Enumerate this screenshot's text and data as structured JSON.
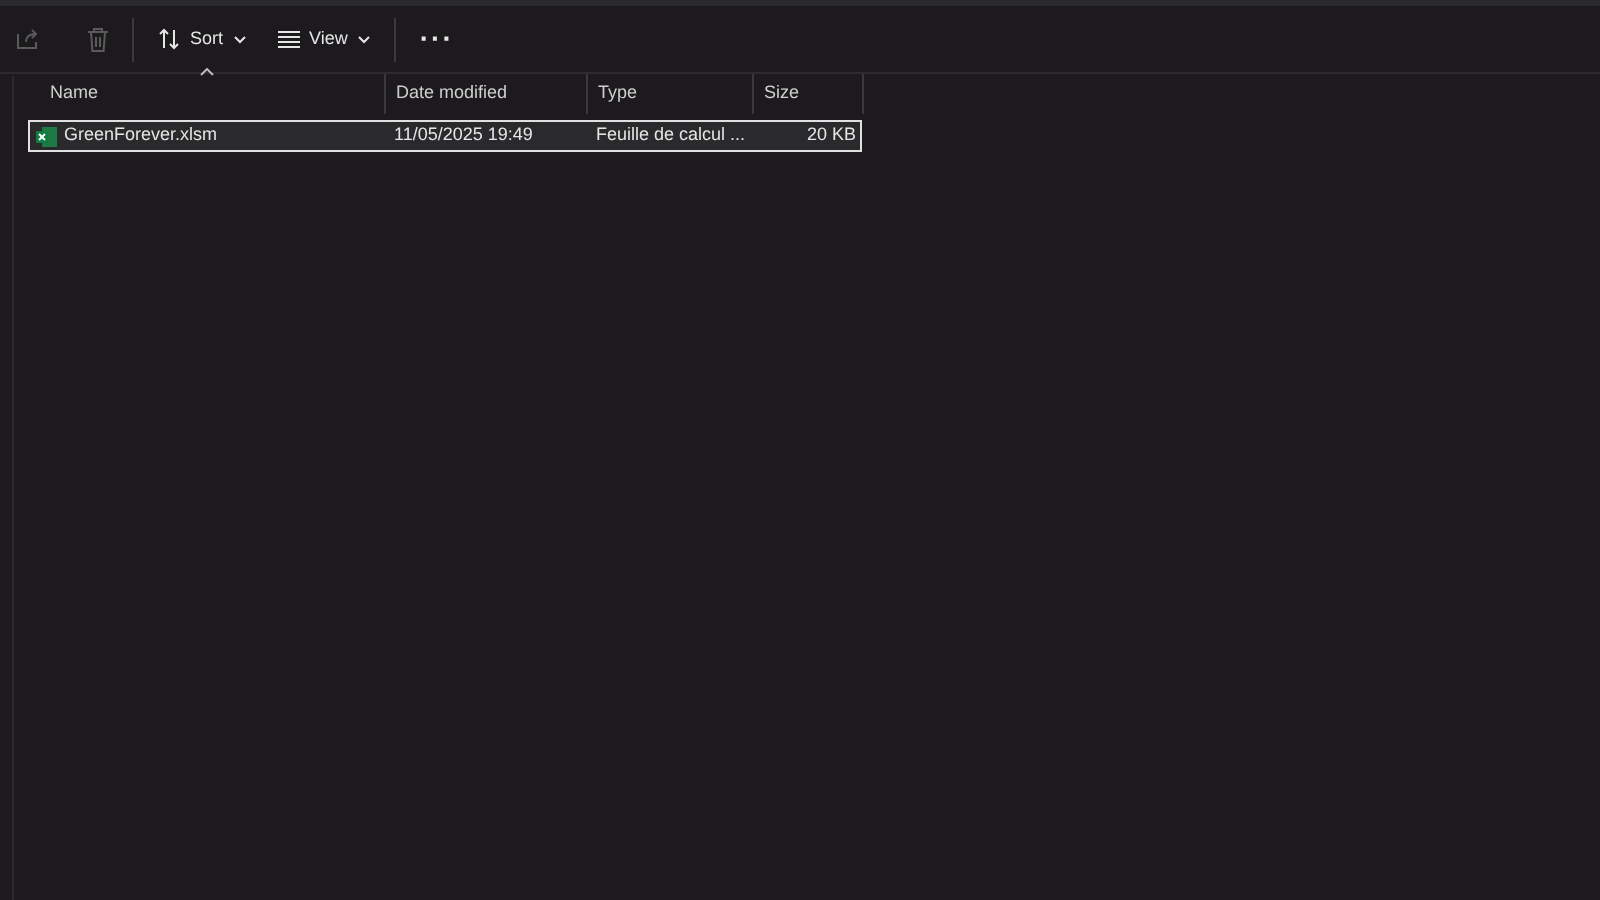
{
  "toolbar": [
    {
      "kind": "share",
      "disabled": true
    },
    {
      "kind": "delete",
      "disabled": true
    },
    {
      "kind": "sort",
      "label": "Sort",
      "disabled": false
    },
    {
      "kind": "view",
      "label": "View",
      "disabled": false
    },
    {
      "kind": "more",
      "label": "···",
      "disabled": false
    }
  ],
  "columns": [
    {
      "label": "Name",
      "sorted": true
    },
    {
      "label": "Date modified",
      "sorted": false
    },
    {
      "label": "Type",
      "sorted": false
    },
    {
      "label": "Size",
      "sorted": false
    }
  ],
  "rows": [
    {
      "name": "GreenForever.xlsm",
      "date": "11/05/2025 19:49",
      "type": "Feuille de calcul ...",
      "size": "20 KB",
      "selected": true
    }
  ]
}
